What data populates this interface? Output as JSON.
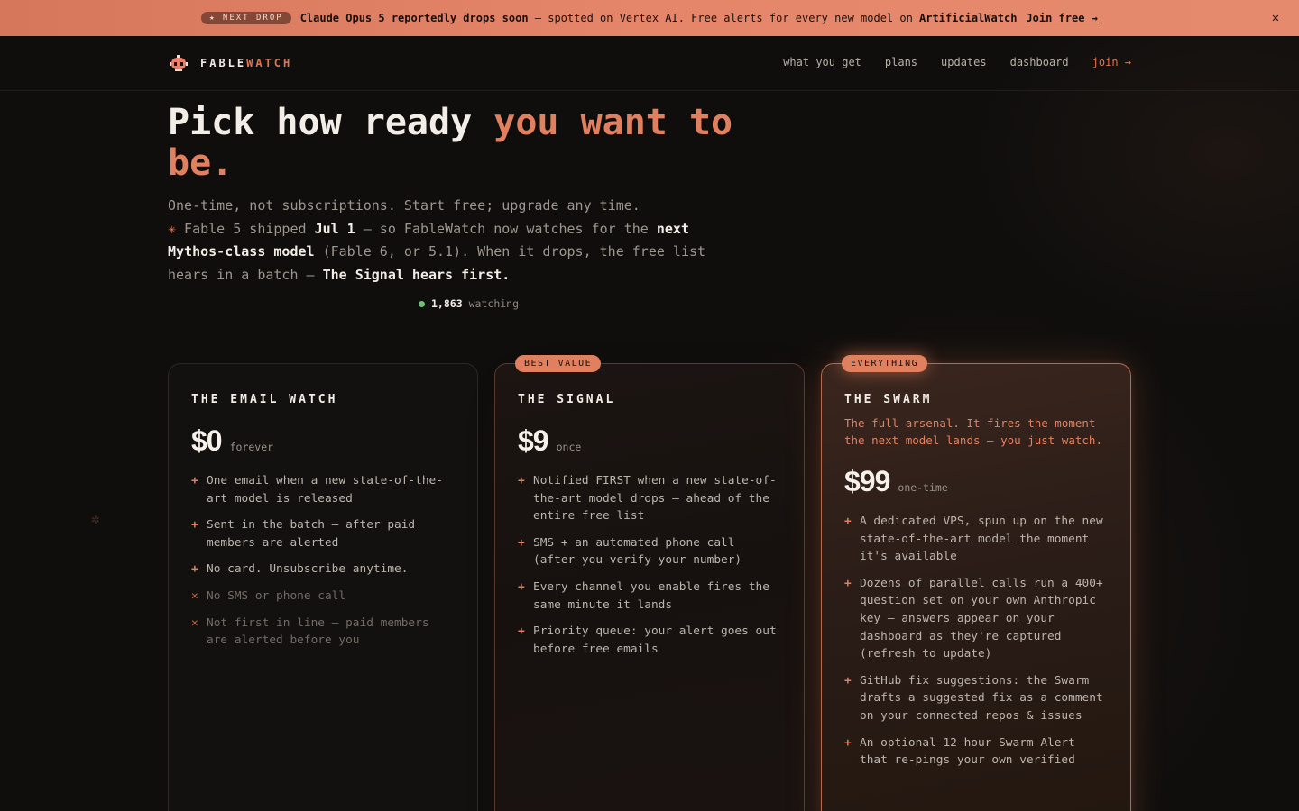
{
  "banner": {
    "pill": "★ NEXT DROP",
    "headline": "Claude Opus 5 reportedly drops soon",
    "text_mid": " — spotted on Vertex AI. Free alerts for every new model on ",
    "brand": "ArtificialWatch",
    "join": "Join free →",
    "close": "✕"
  },
  "nav": {
    "brand_a": "FABLE",
    "brand_b": "WATCH",
    "links": [
      "what you get",
      "plans",
      "updates",
      "dashboard"
    ],
    "join": "join →"
  },
  "hero": {
    "title_a": "Pick how ready ",
    "title_b": "you want to be.",
    "line1": "One-time, not subscriptions. Start free; upgrade any time.",
    "star": "✳",
    "line2a": " Fable 5 shipped ",
    "line2b": "Jul 1",
    "line2c": " — so FableWatch now watches for the ",
    "line2d": "next Mythos-class model",
    "line2e": " (Fable 6, or 5.1). When it drops, the free list hears in a batch — ",
    "line2f": "The Signal hears first.",
    "watch_count": "1,863",
    "watch_label": "watching"
  },
  "plans": [
    {
      "title": "THE EMAIL WATCH",
      "price": "$0",
      "period": "forever",
      "features": [
        {
          "text": "One email when a new state-of-the-art model is released",
          "included": true
        },
        {
          "text": "Sent in the batch — after paid members are alerted",
          "included": true
        },
        {
          "text": "No card. Unsubscribe anytime.",
          "included": true
        },
        {
          "text": "No SMS or phone call",
          "included": false
        },
        {
          "text": "Not first in line — paid members are alerted before you",
          "included": false
        }
      ]
    },
    {
      "badge": "BEST VALUE",
      "title": "THE SIGNAL",
      "price": "$9",
      "period": "once",
      "features": [
        {
          "text": "Notified FIRST when a new state-of-the-art model drops — ahead of the entire free list",
          "included": true
        },
        {
          "text": "SMS + an automated phone call (after you verify your number)",
          "included": true
        },
        {
          "text": "Every channel you enable fires the same minute it lands",
          "included": true
        },
        {
          "text": "Priority queue: your alert goes out before free emails",
          "included": true
        }
      ]
    },
    {
      "badge": "EVERYTHING",
      "title": "THE SWARM",
      "description": "The full arsenal. It fires the moment the next model lands — you just watch.",
      "price": "$99",
      "period": "one-time",
      "features": [
        {
          "text": "A dedicated VPS, spun up on the new state-of-the-art model the moment it's available",
          "included": true
        },
        {
          "text": "Dozens of parallel calls run a 400+ question set on your own Anthropic key — answers appear on your dashboard as they're captured (refresh to update)",
          "included": true
        },
        {
          "text": "GitHub fix suggestions: the Swarm drafts a suggested fix as a comment on your connected repos & issues",
          "included": true
        },
        {
          "text": "An optional 12-hour Swarm Alert that re-pings your own verified",
          "included": true
        }
      ]
    }
  ],
  "icons": {
    "include": "+",
    "exclude": "✕",
    "side_gear": "✲"
  },
  "colors": {
    "accent": "#e0805f",
    "banner": "#e5866a",
    "background": "#0f0e0d",
    "online": "#6fc07a"
  }
}
